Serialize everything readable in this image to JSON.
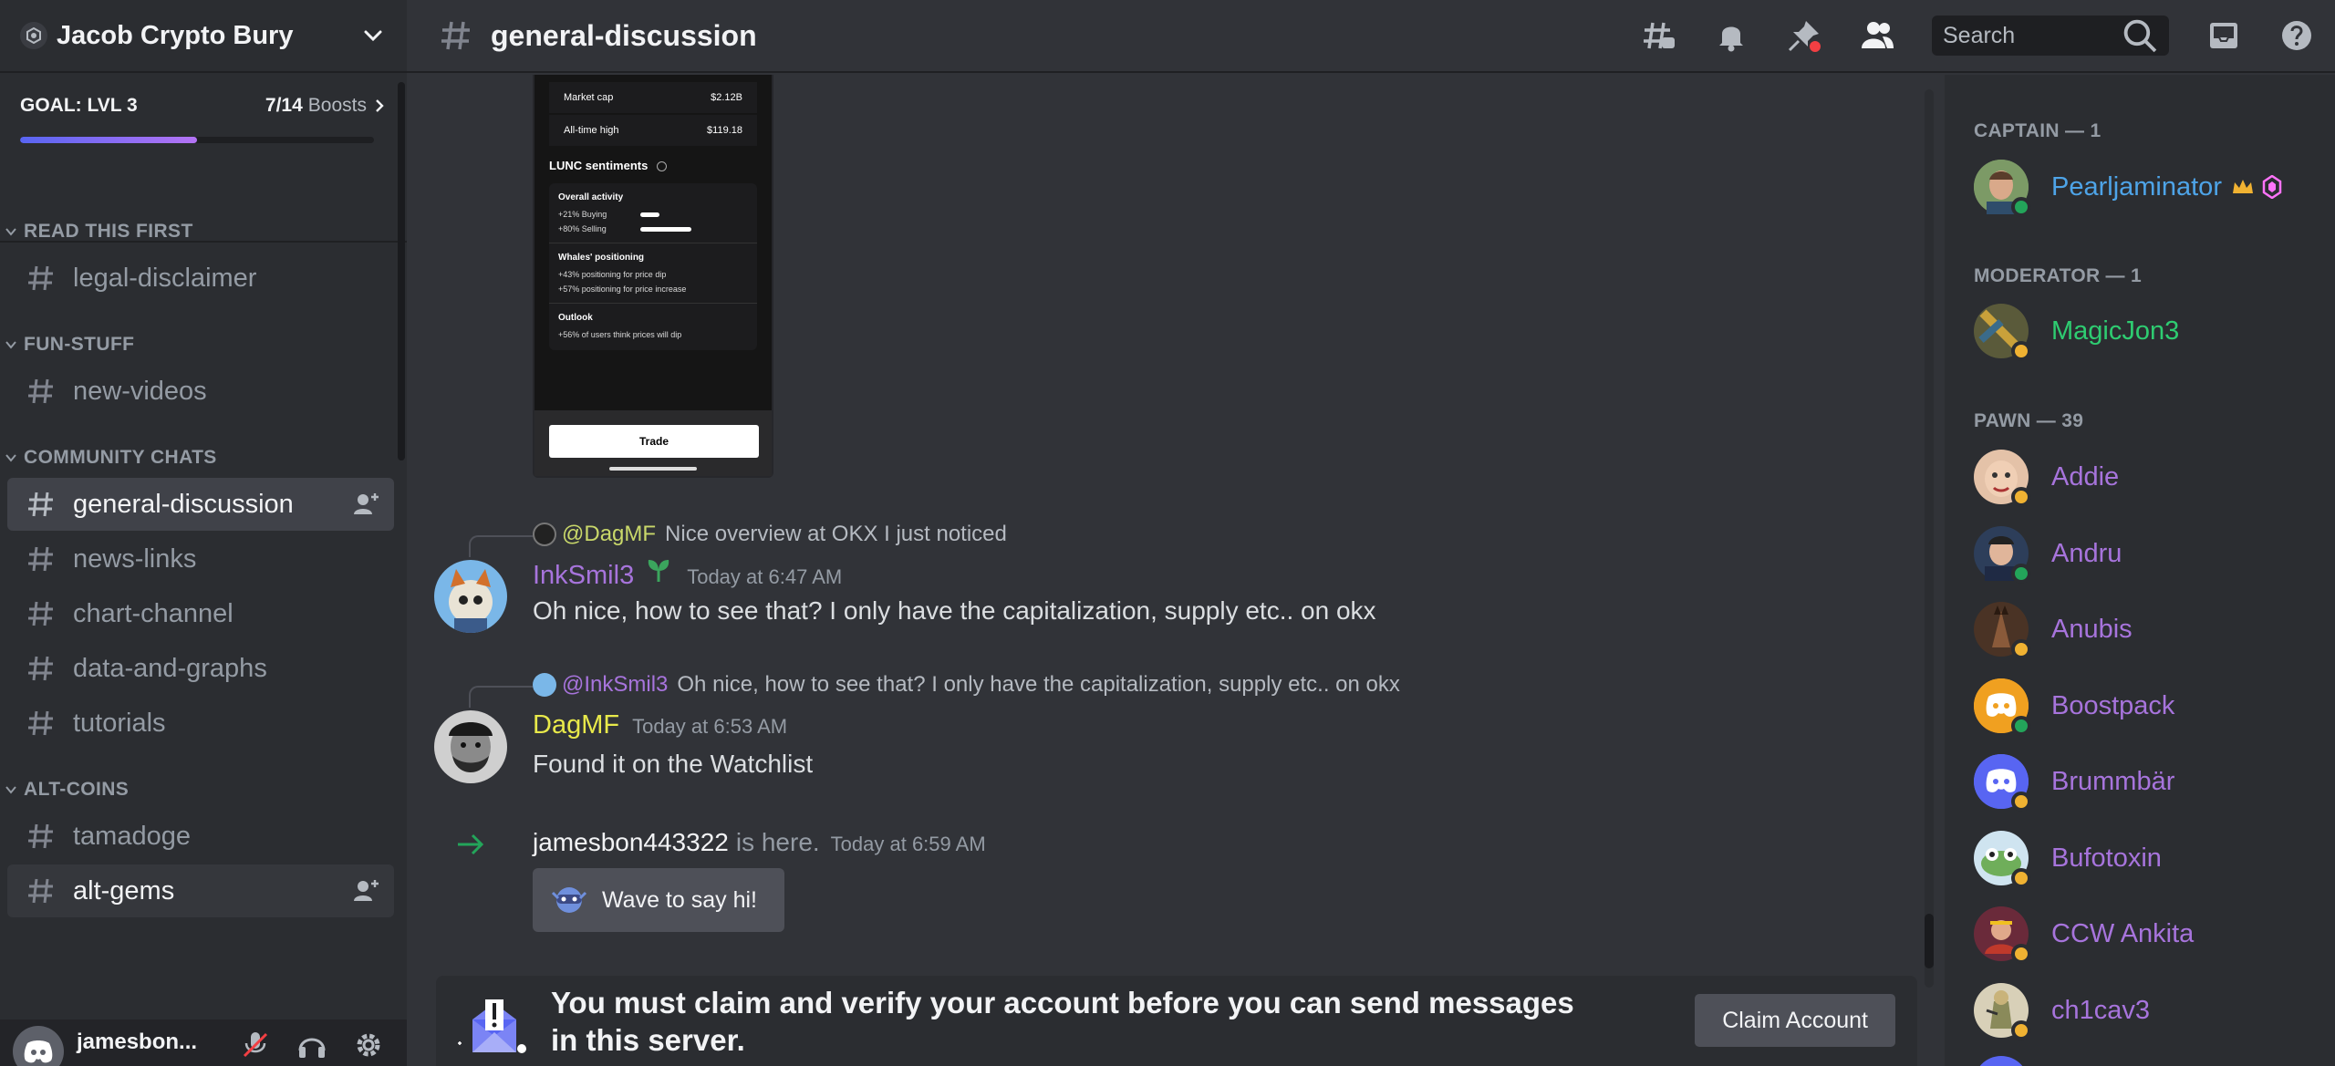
{
  "server": {
    "name": "Jacob Crypto Bury"
  },
  "boost": {
    "goal": "GOAL: LVL 3",
    "count": "7/14",
    "suffix": "Boosts",
    "progress": 0.5
  },
  "categories": [
    {
      "name": "READ THIS FIRST",
      "channels": [
        "legal-disclaimer"
      ]
    },
    {
      "name": "FUN-STUFF",
      "channels": [
        "new-videos"
      ]
    },
    {
      "name": "COMMUNITY CHATS",
      "channels": [
        "general-discussion",
        "news-links",
        "chart-channel",
        "data-and-graphs",
        "tutorials"
      ]
    },
    {
      "name": "ALT-COINS",
      "channels": [
        "tamadoge",
        "alt-gems"
      ]
    }
  ],
  "user": {
    "name": "jamesbon..."
  },
  "topbar": {
    "channel": "general-discussion",
    "search_placeholder": "Search"
  },
  "embed": {
    "market_cap_label": "Market cap",
    "market_cap_value": "$2.12B",
    "ath_label": "All-time high",
    "ath_value": "$119.18",
    "sentiments_title": "LUNC sentiments",
    "overall_title": "Overall activity",
    "buying": "+21% Buying",
    "selling": "+80% Selling",
    "buying_fraction": 0.21,
    "selling_fraction": 0.8,
    "whales_title": "Whales' positioning",
    "whales_dip": "+43% positioning for price dip",
    "whales_up": "+57% positioning for price increase",
    "outlook_title": "Outlook",
    "outlook_text": "+56% of users think prices will dip",
    "trade_label": "Trade"
  },
  "messages": [
    {
      "reply_mention": "@DagMF",
      "reply_text": "Nice overview at OKX I just noticed",
      "author": "InkSmil3",
      "time": "Today at 6:47 AM",
      "text": "Oh nice, how to see that? I only have the capitalization, supply etc.. on okx"
    },
    {
      "reply_mention": "@InkSmil3",
      "reply_text": "Oh nice, how to see that? I only have the capitalization, supply etc.. on okx",
      "author": "DagMF",
      "time": "Today at 6:53 AM",
      "text": "Found it on the Watchlist"
    }
  ],
  "join": {
    "user": "jamesbon443322",
    "suffix": "is here.",
    "time": "Today at 6:59 AM",
    "wave_label": "Wave to say hi!"
  },
  "claim": {
    "text": "You must claim and verify your account before you can send messages in this server.",
    "button": "Claim Account"
  },
  "members": {
    "groups": [
      {
        "title": "CAPTAIN — 1"
      },
      {
        "title": "MODERATOR — 1"
      },
      {
        "title": "PAWN — 39"
      }
    ],
    "list": [
      {
        "name": "Pearljaminator",
        "color": "#4ea4e8",
        "status": "online"
      },
      {
        "name": "MagicJon3",
        "color": "#2ecc71",
        "status": "idle"
      },
      {
        "name": "Addie",
        "color": "#a774dc",
        "status": "idle"
      },
      {
        "name": "Andru",
        "color": "#a774dc",
        "status": "online"
      },
      {
        "name": "Anubis",
        "color": "#a774dc",
        "status": "idle"
      },
      {
        "name": "Boostpack",
        "color": "#a774dc",
        "status": "online"
      },
      {
        "name": "Brummbär",
        "color": "#a774dc",
        "status": "idle"
      },
      {
        "name": "Bufotoxin",
        "color": "#a774dc",
        "status": "idle"
      },
      {
        "name": "CCW Ankita",
        "color": "#a774dc",
        "status": "idle"
      },
      {
        "name": "ch1cav3",
        "color": "#a774dc",
        "status": "idle"
      }
    ]
  }
}
